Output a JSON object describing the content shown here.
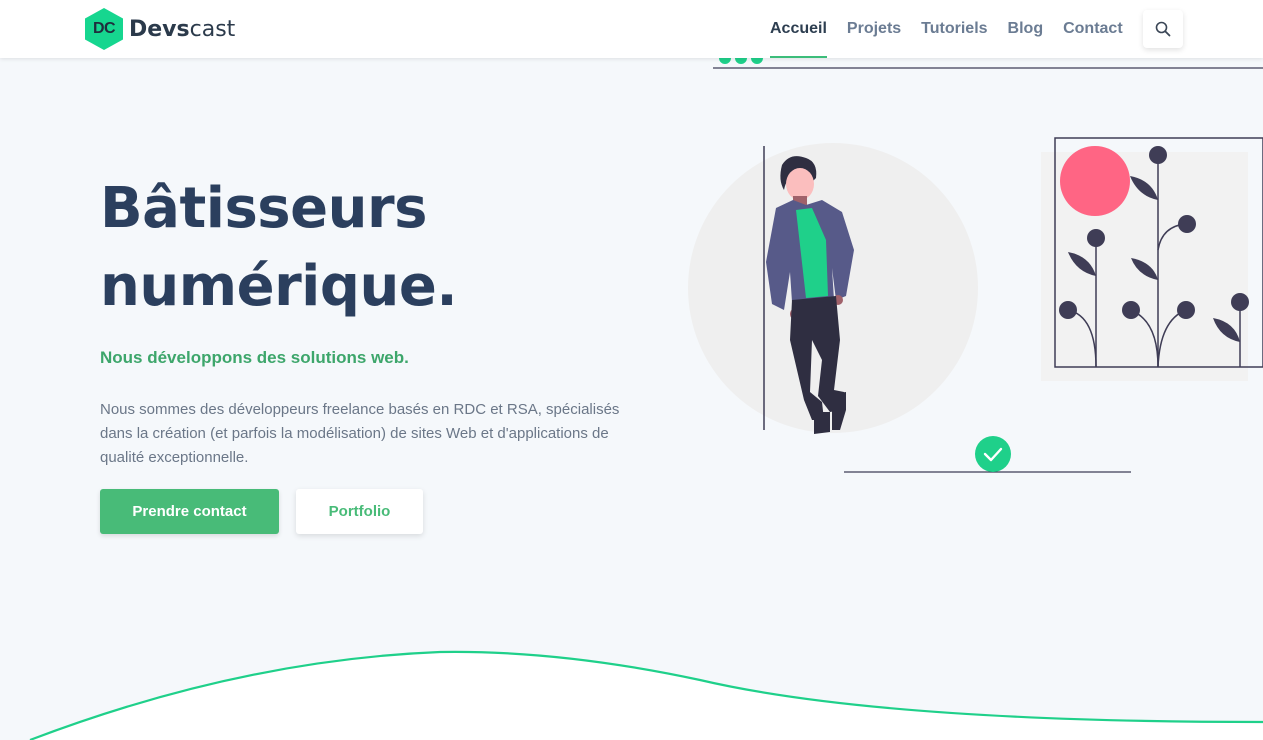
{
  "brand": {
    "logo_mark": "DC",
    "name_bold": "Devs",
    "name_rest": "cast",
    "accent": "#16d68f"
  },
  "nav": {
    "items": [
      {
        "label": "Accueil",
        "active": true
      },
      {
        "label": "Projets",
        "active": false
      },
      {
        "label": "Tutoriels",
        "active": false
      },
      {
        "label": "Blog",
        "active": false
      },
      {
        "label": "Contact",
        "active": false
      }
    ],
    "search_icon": "search-icon"
  },
  "hero": {
    "title_line1": "Bâtisseurs",
    "title_line2": "numérique.",
    "subtitle": "Nous développons des solutions web.",
    "description": "Nous sommes des développeurs freelance basés en RDC et RSA, spécialisés dans la création (et parfois la modélisation) de sites Web et d'applications de qualité exceptionnelle.",
    "primary_button": "Prendre contact",
    "secondary_button": "Portfolio"
  },
  "colors": {
    "title": "#2b3f5e",
    "green": "#48bb78",
    "subtitle_green": "#3da66b",
    "text_gray": "#6b7788",
    "page_background": "#f5f8fb",
    "illustration_pink": "#ff6584",
    "illustration_dark": "#3f3d56",
    "wave": "#1fd08a"
  }
}
